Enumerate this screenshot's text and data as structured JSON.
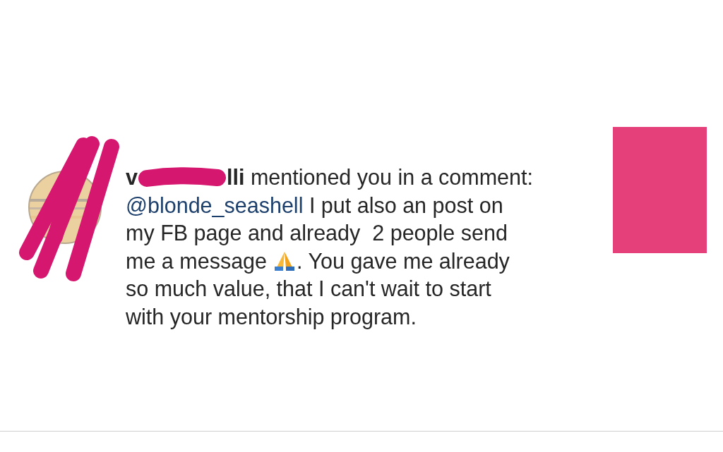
{
  "notification": {
    "username_parts": [
      "v",
      "lli"
    ],
    "action": "mentioned you in a comment:",
    "mention": "@blonde_seashell",
    "comment_before": " I put also an post on\nmy FB page and already  2 people send\nme a message",
    "comment_after": ". You gave me already\nso much value, that I can't wait to start\nwith your mentorship program."
  }
}
